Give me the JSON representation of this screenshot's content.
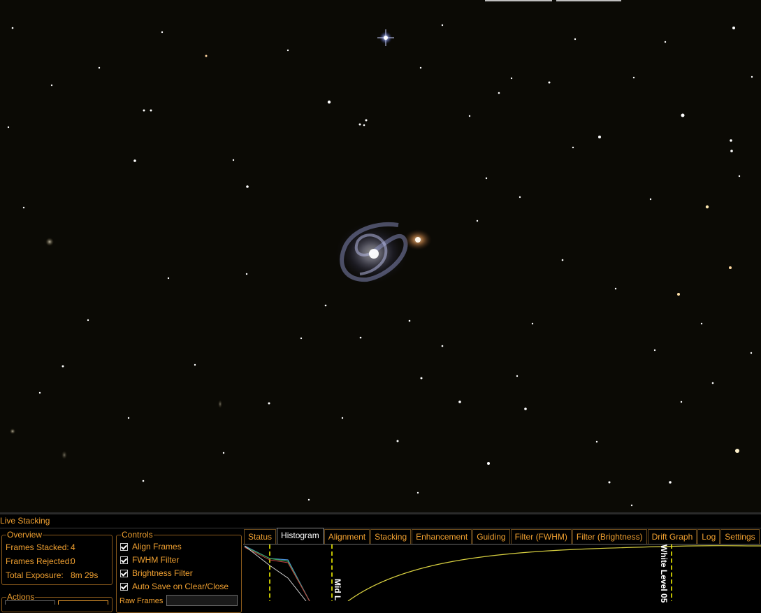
{
  "panel": {
    "title": "Live Stacking"
  },
  "overview": {
    "legend": "Overview",
    "frames_stacked_label": "Frames Stacked:",
    "frames_stacked_value": "4",
    "frames_rejected_label": "Frames Rejected:",
    "frames_rejected_value": "0",
    "total_exposure_label": "Total Exposure:",
    "total_exposure_value": "8m 29s"
  },
  "controls": {
    "legend": "Controls",
    "align_frames": {
      "label": "Align Frames",
      "checked": true
    },
    "fwhm_filter": {
      "label": "FWHM Filter",
      "checked": true
    },
    "brightness_filter": {
      "label": "Brightness Filter",
      "checked": true
    },
    "auto_save": {
      "label": "Auto Save on Clear/Close",
      "checked": true
    },
    "partial_label": "Raw Frames"
  },
  "actions": {
    "legend": "Actions"
  },
  "tabs": {
    "status": "Status",
    "histogram": "Histogram",
    "alignment": "Alignment",
    "stacking": "Stacking",
    "enhancement": "Enhancement",
    "guiding": "Guiding",
    "filter_fwhm": "Filter (FWHM)",
    "filter_brightness": "Filter (Brightness)",
    "drift_graph": "Drift Graph",
    "log": "Log",
    "settings": "Settings",
    "active": "Histogram"
  },
  "histogram": {
    "mid_label": "Mid L",
    "white_label": "White Level  05"
  },
  "colors": {
    "accent": "#f0a030",
    "sky": "#0b0a05",
    "guide_line": "#ffff00",
    "curve": "#d8d040"
  }
}
